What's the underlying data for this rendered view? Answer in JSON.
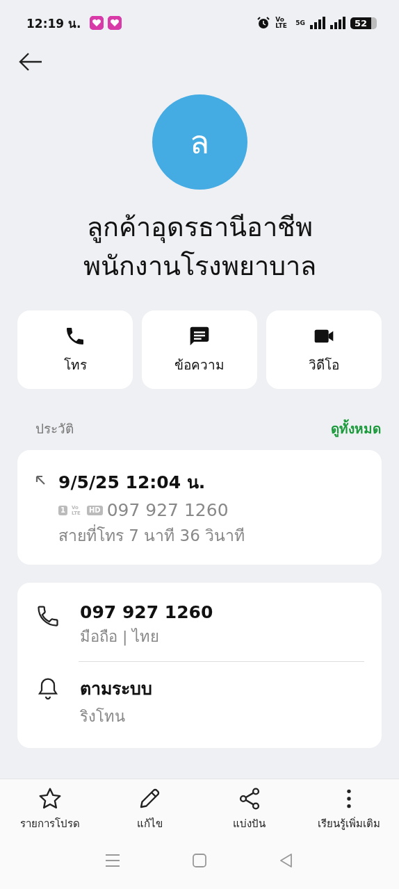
{
  "status_bar": {
    "time": "12:19 น.",
    "volte": "Vo LTE",
    "network": "5G",
    "battery": "52"
  },
  "contact": {
    "initial": "ล",
    "name": "ลูกค้าอุดรธานีอาชีพ\nพนักงานโรงพยาบาล"
  },
  "actions": [
    {
      "kind": "call",
      "label": "โทร"
    },
    {
      "kind": "message",
      "label": "ข้อความ"
    },
    {
      "kind": "video",
      "label": "วิดีโอ"
    }
  ],
  "history": {
    "title": "ประวัติ",
    "see_all": "ดูทั้งหมด",
    "entries": [
      {
        "kind": "outgoing",
        "datetime": "9/5/25 12:04 น.",
        "badges": [
          {
            "kind": "sim",
            "text": "1"
          },
          {
            "kind": "volte",
            "text": "Vo LTE"
          },
          {
            "kind": "hd",
            "text": "HD"
          }
        ],
        "number": "097 927 1260",
        "duration": "สายที่โทร  7 นาที 36 วินาที"
      }
    ]
  },
  "details": [
    {
      "kind": "phone",
      "primary": "097 927 1260",
      "secondary": "มือถือ  |  ไทย"
    },
    {
      "kind": "ringtone",
      "primary": "ตามระบบ",
      "secondary": "ริงโทน"
    }
  ],
  "bottom_bar": [
    {
      "kind": "favorite",
      "label": "รายการโปรด"
    },
    {
      "kind": "edit",
      "label": "แก้ไข"
    },
    {
      "kind": "share",
      "label": "แบ่งปัน"
    },
    {
      "kind": "more",
      "label": "เรียนรู้เพิ่มเติม"
    }
  ]
}
